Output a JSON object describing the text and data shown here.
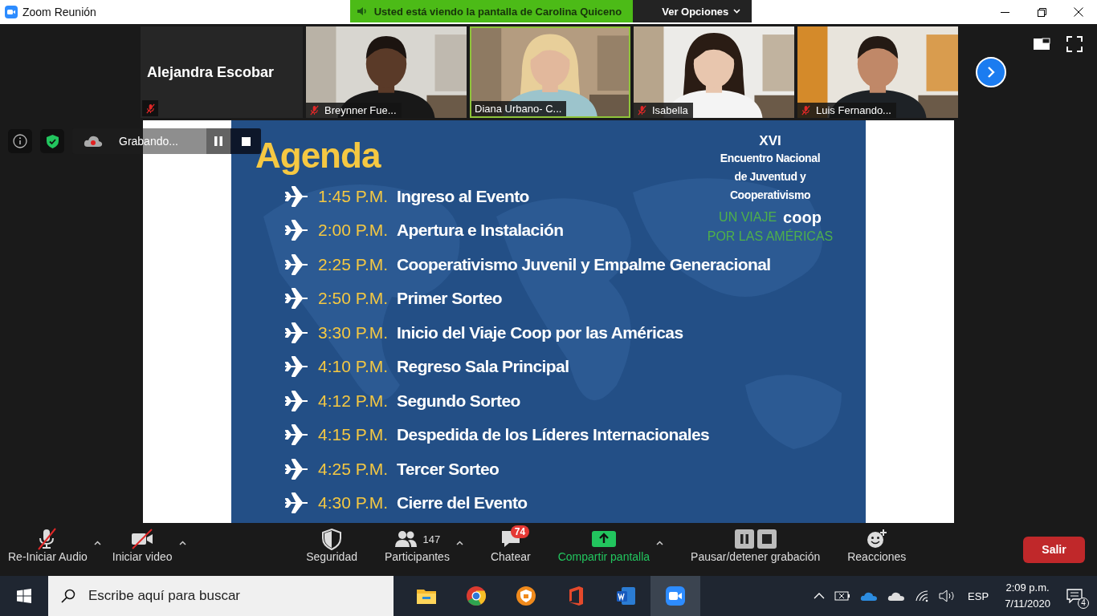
{
  "window": {
    "title": "Zoom Reunión"
  },
  "share_banner": {
    "text": "Usted está viendo la pantalla de Carolina Quiceno",
    "button": "Ver Opciones"
  },
  "participants": [
    {
      "name": "Alejandra Escobar",
      "kind": "name-only",
      "muted": true,
      "speaking": false
    },
    {
      "name": "Breynner Fue...",
      "kind": "video",
      "muted": true,
      "speaking": false
    },
    {
      "name": "Diana Urbano- C...",
      "kind": "video",
      "muted": false,
      "speaking": true
    },
    {
      "name": "Isabella",
      "kind": "video",
      "muted": true,
      "speaking": false
    },
    {
      "name": "Luis Fernando...",
      "kind": "video",
      "muted": true,
      "speaking": false
    }
  ],
  "recording": {
    "label": "Grabando..."
  },
  "slide": {
    "title": "Agenda",
    "event": {
      "edition": "XVI",
      "name_lines": [
        "Encuentro Nacional",
        "de Juventud y",
        "Cooperativismo"
      ],
      "tagline_1": "UN VIAJE",
      "logo": "coop",
      "tagline_2": "POR LAS AMÉRICAS"
    },
    "items": [
      {
        "time": "1:45 P.M.",
        "label": "Ingreso al Evento"
      },
      {
        "time": "2:00 P.M.",
        "label": "Apertura e Instalación"
      },
      {
        "time": "2:25 P.M.",
        "label": "Cooperativismo Juvenil y Empalme Generacional"
      },
      {
        "time": "2:50 P.M.",
        "label": "Primer Sorteo"
      },
      {
        "time": "3:30 P.M.",
        "label": "Inicio del Viaje Coop por las Américas"
      },
      {
        "time": "4:10 P.M.",
        "label": "Regreso Sala Principal"
      },
      {
        "time": "4:12 P.M.",
        "label": "Segundo Sorteo"
      },
      {
        "time": "4:15 P.M.",
        "label": "Despedida de los Líderes Internacionales"
      },
      {
        "time": "4:25 P.M.",
        "label": "Tercer Sorteo"
      },
      {
        "time": "4:30 P.M.",
        "label": "Cierre del Evento"
      }
    ]
  },
  "toolbar": {
    "buttons": [
      {
        "kind": "audio",
        "label": "Re-Iniciar Audio",
        "off": true,
        "menu": true
      },
      {
        "kind": "video",
        "label": "Iniciar video",
        "off": true,
        "menu": true
      },
      {
        "kind": "security",
        "label": "Seguridad",
        "menu": false
      },
      {
        "kind": "participants",
        "label": "Participantes",
        "count": "147",
        "menu": true
      },
      {
        "kind": "chat",
        "label": "Chatear",
        "badge": "74",
        "menu": false
      },
      {
        "kind": "share",
        "label": "Compartir pantalla",
        "menu": true
      },
      {
        "kind": "record",
        "label": "Pausar/detener grabación",
        "menu": false
      },
      {
        "kind": "reactions",
        "label": "Reacciones",
        "menu": false
      }
    ],
    "leave": "Salir"
  },
  "taskbar": {
    "search_placeholder": "Escribe aquí para buscar",
    "apps": [
      {
        "kind": "folder",
        "active": false
      },
      {
        "kind": "chrome",
        "active": false
      },
      {
        "kind": "shield",
        "active": false
      },
      {
        "kind": "office",
        "active": false
      },
      {
        "kind": "word",
        "active": false
      },
      {
        "kind": "zoom",
        "active": true
      }
    ],
    "language": "ESP",
    "time": "2:09 p.m.",
    "date": "7/11/2020",
    "notifications": "4"
  }
}
